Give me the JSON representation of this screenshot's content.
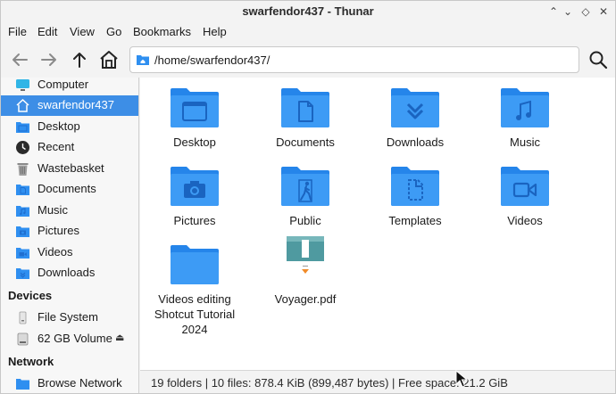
{
  "window": {
    "title": "swarfendor437 - Thunar",
    "controls": [
      "chevron-up-icon",
      "minimize-icon",
      "maximize-icon",
      "close-icon"
    ]
  },
  "menubar": [
    "File",
    "Edit",
    "View",
    "Go",
    "Bookmarks",
    "Help"
  ],
  "toolbar": {
    "buttons": [
      "back-arrow-icon",
      "forward-arrow-icon",
      "up-arrow-icon",
      "home-icon"
    ],
    "location": "/home/swarfendor437/",
    "search_icon": "search-icon"
  },
  "sidebar": {
    "places": [
      {
        "label": "Computer",
        "icon": "monitor-icon"
      },
      {
        "label": "swarfendor437",
        "icon": "home-icon",
        "selected": true
      },
      {
        "label": "Desktop",
        "icon": "desktop-folder-icon"
      },
      {
        "label": "Recent",
        "icon": "clock-icon"
      },
      {
        "label": "Wastebasket",
        "icon": "trash-icon"
      },
      {
        "label": "Documents",
        "icon": "documents-folder-icon"
      },
      {
        "label": "Music",
        "icon": "music-folder-icon"
      },
      {
        "label": "Pictures",
        "icon": "pictures-folder-icon"
      },
      {
        "label": "Videos",
        "icon": "videos-folder-icon"
      },
      {
        "label": "Downloads",
        "icon": "downloads-folder-icon"
      }
    ],
    "devices_header": "Devices",
    "devices": [
      {
        "label": "File System",
        "icon": "drive-icon"
      },
      {
        "label": "62 GB Volume",
        "icon": "usb-drive-icon",
        "eject": "⏏"
      }
    ],
    "network_header": "Network",
    "network": [
      {
        "label": "Browse Network",
        "icon": "network-folder-icon"
      }
    ]
  },
  "files": [
    {
      "name": "Desktop",
      "icon": "desktop-folder-icon"
    },
    {
      "name": "Documents",
      "icon": "documents-folder-icon"
    },
    {
      "name": "Downloads",
      "icon": "downloads-folder-icon"
    },
    {
      "name": "Music",
      "icon": "music-folder-icon"
    },
    {
      "name": "Pictures",
      "icon": "pictures-folder-icon"
    },
    {
      "name": "Public",
      "icon": "public-folder-icon"
    },
    {
      "name": "Templates",
      "icon": "templates-folder-icon"
    },
    {
      "name": "Videos",
      "icon": "videos-folder-icon"
    },
    {
      "name": "Videos editing Shotcut Tutorial 2024",
      "icon": "folder-icon"
    },
    {
      "name": "Voyager.pdf",
      "icon": "pdf-thumbnail-icon"
    }
  ],
  "statusbar": {
    "text": "19 folders  |  10 files: 878.4 KiB (899,487 bytes)  |  Free space: 21.2 GiB"
  },
  "colors": {
    "accent": "#3d8ee6",
    "folder": "#2f8ff0",
    "folder_dark": "#1f6fd0"
  }
}
